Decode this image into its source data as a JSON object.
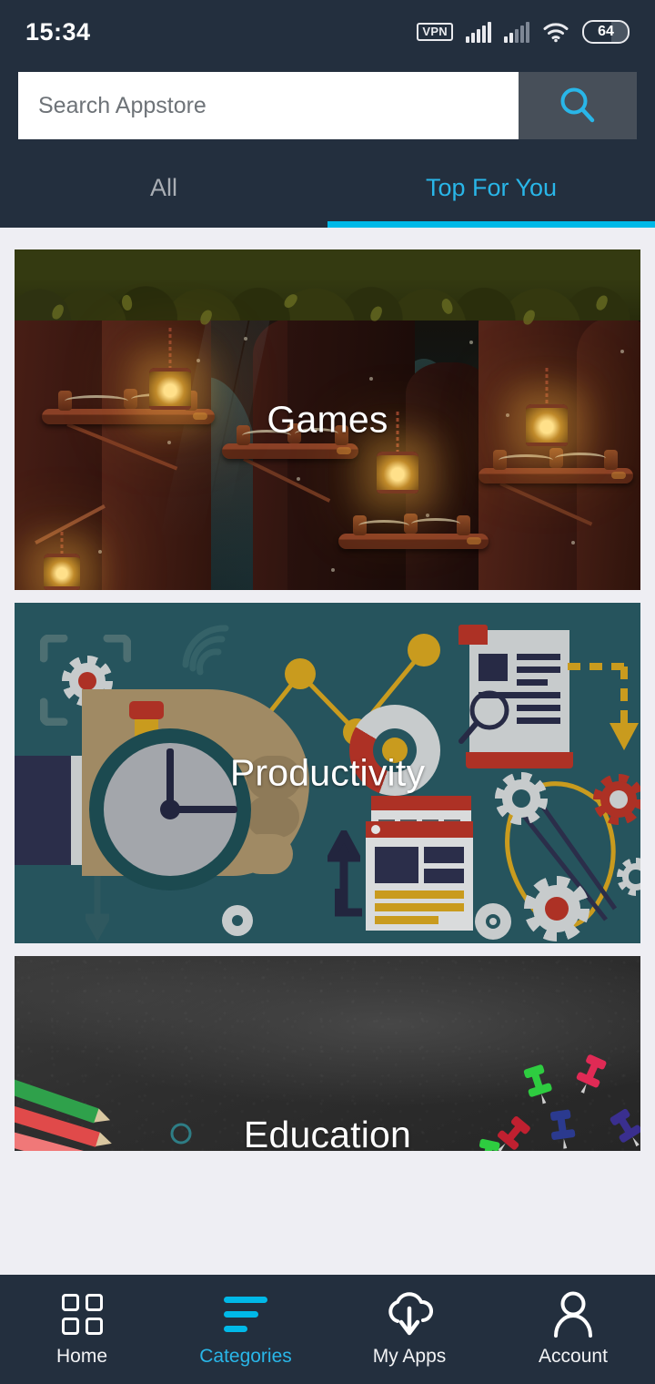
{
  "statusbar": {
    "time": "15:34",
    "vpn_label": "VPN",
    "battery_level": "64",
    "icons": [
      "vpn-icon",
      "cellular-signal-icon",
      "cellular-signal-secondary-icon",
      "wifi-icon",
      "battery-icon"
    ]
  },
  "search": {
    "placeholder": "Search Appstore",
    "value": "",
    "button_icon": "search-icon",
    "accent": "#29B6E8"
  },
  "tabs": [
    {
      "label": "All",
      "active": false
    },
    {
      "label": "Top For You",
      "active": true
    }
  ],
  "theme": {
    "header_bg": "#232F3E",
    "page_bg": "#EEEEF3",
    "accent": "#00B9E8",
    "nav_bg": "#232F3E",
    "search_button_bg": "#474F59"
  },
  "categories": [
    {
      "title": "Games",
      "art": "dark-forest-lanterns"
    },
    {
      "title": "Productivity",
      "art": "flat-icons-teal"
    },
    {
      "title": "Education",
      "art": "chalkboard-pencils"
    }
  ],
  "bottom_nav": [
    {
      "label": "Home",
      "icon": "grid-icon",
      "active": false
    },
    {
      "label": "Categories",
      "icon": "list-lines-icon",
      "active": true
    },
    {
      "label": "My Apps",
      "icon": "cloud-download-icon",
      "active": false
    },
    {
      "label": "Account",
      "icon": "person-icon",
      "active": false
    }
  ]
}
